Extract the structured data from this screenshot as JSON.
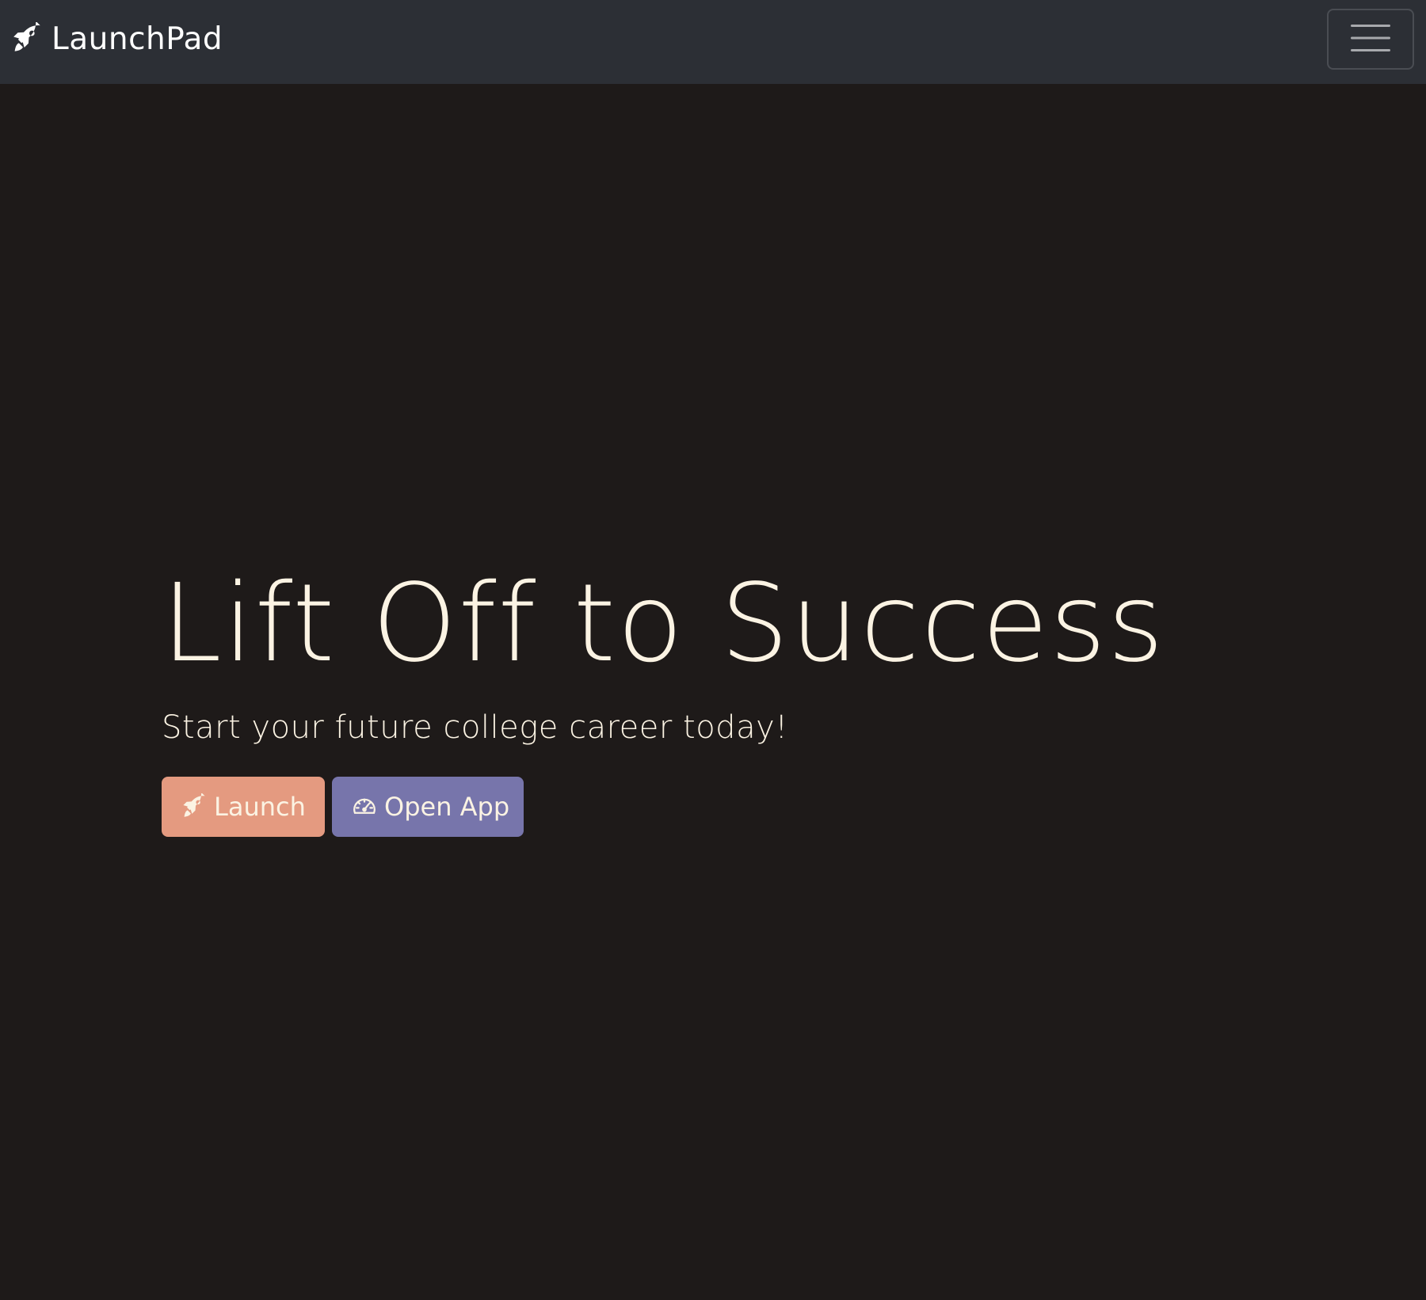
{
  "navbar": {
    "brand_icon": "rocket-icon",
    "brand_label": "LaunchPad",
    "menu_icon": "hamburger-menu-icon",
    "background": "#2c2f35"
  },
  "hero": {
    "title": "Lift Off to Success",
    "subtitle": "Start your future college career today!",
    "text_color": "#fbf3e3"
  },
  "actions": {
    "launch": {
      "label": "Launch",
      "icon": "rocket-icon",
      "color": "#e49a80"
    },
    "open_app": {
      "label": "Open App",
      "icon": "speedometer-icon",
      "color": "#7775ab"
    }
  },
  "page_background": "#1e1a19"
}
